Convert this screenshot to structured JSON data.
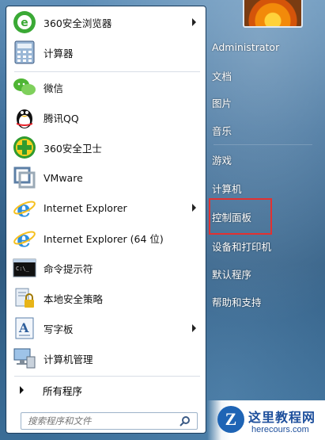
{
  "left_menu": {
    "programs": [
      {
        "label": "360安全浏览器",
        "icon": "360-browser-icon",
        "has_submenu": true
      },
      {
        "label": "计算器",
        "icon": "calculator-icon",
        "has_submenu": false
      },
      {
        "label": "微信",
        "icon": "wechat-icon",
        "has_submenu": false
      },
      {
        "label": "腾讯QQ",
        "icon": "qq-penguin-icon",
        "has_submenu": false
      },
      {
        "label": "360安全卫士",
        "icon": "360-security-icon",
        "has_submenu": false
      },
      {
        "label": "VMware",
        "icon": "vmware-icon",
        "has_submenu": false
      },
      {
        "label": "Internet Explorer",
        "icon": "ie-icon",
        "has_submenu": true
      },
      {
        "label": "Internet Explorer (64 位)",
        "icon": "ie-icon",
        "has_submenu": false
      },
      {
        "label": "命令提示符",
        "icon": "cmd-icon",
        "has_submenu": false
      },
      {
        "label": "本地安全策略",
        "icon": "security-policy-icon",
        "has_submenu": false
      },
      {
        "label": "写字板",
        "icon": "wordpad-icon",
        "has_submenu": true
      },
      {
        "label": "计算机管理",
        "icon": "computer-management-icon",
        "has_submenu": false
      }
    ],
    "all_programs": "所有程序",
    "search_placeholder": "搜索程序和文件"
  },
  "right_menu": {
    "user": "Administrator",
    "items": [
      "文档",
      "图片",
      "音乐",
      "游戏",
      "计算机",
      "控制面板",
      "设备和打印机",
      "默认程序",
      "帮助和支持"
    ],
    "highlighted": "控制面板"
  },
  "watermark": {
    "brand_cn": "这里教程网",
    "brand_url": "herecours.com"
  }
}
